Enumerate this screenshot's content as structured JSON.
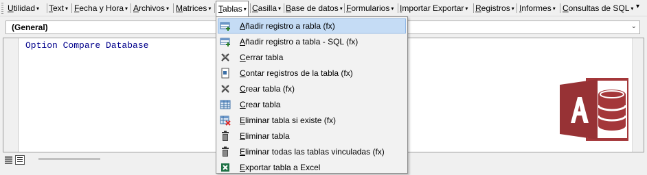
{
  "menubar": {
    "items": [
      {
        "first": "U",
        "rest": "tilidad"
      },
      {
        "first": "T",
        "rest": "ext"
      },
      {
        "first": "F",
        "rest": "echa y Hora"
      },
      {
        "first": "A",
        "rest": "rchivos"
      },
      {
        "first": "M",
        "rest": "atrices"
      },
      {
        "first": "T",
        "rest": "ablas"
      },
      {
        "first": "C",
        "rest": "asilla"
      },
      {
        "first": "B",
        "rest": "ase de datos"
      },
      {
        "first": "F",
        "rest": "ormularios"
      },
      {
        "first": "I",
        "rest": "mportar Exportar"
      },
      {
        "first": "R",
        "rest": "egistros"
      },
      {
        "first": "I",
        "rest": "nformes"
      },
      {
        "first": "C",
        "rest": "onsultas de SQL"
      }
    ],
    "arrow": "▾",
    "overflow": "▾"
  },
  "procedure_combo": {
    "value": "(General)",
    "arrow": "⌄"
  },
  "code": {
    "line1": "Option Compare Database"
  },
  "dropdown": {
    "items": [
      {
        "first": "A",
        "rest": "ñadir registro a rabla (fx)",
        "icon": "table-add-icon",
        "highlighted": true
      },
      {
        "first": "A",
        "rest": "ñadir registro a tabla - SQL (fx)",
        "icon": "table-add-icon"
      },
      {
        "first": "C",
        "rest": "errar tabla",
        "icon": "close-x-icon"
      },
      {
        "first": "C",
        "rest": "ontar registros de la tabla (fx)",
        "icon": "count-records-icon"
      },
      {
        "first": "C",
        "rest": "rear tabla (fx)",
        "icon": "close-x-icon"
      },
      {
        "first": "C",
        "rest": "rear tabla",
        "icon": "table-grid-icon"
      },
      {
        "first": "E",
        "rest": "liminar tabla si existe (fx)",
        "icon": "table-delete-icon"
      },
      {
        "first": "E",
        "rest": "liminar tabla",
        "icon": "trash-icon"
      },
      {
        "first": "E",
        "rest": "liminar todas las tablas vinculadas (fx)",
        "icon": "trash-icon"
      },
      {
        "first": "E",
        "rest": "xportar tabla a Excel",
        "icon": "excel-icon"
      }
    ]
  },
  "colors": {
    "access_red": "#a4373a",
    "highlight": "#c5dcf5",
    "code_blue": "#00008b"
  }
}
